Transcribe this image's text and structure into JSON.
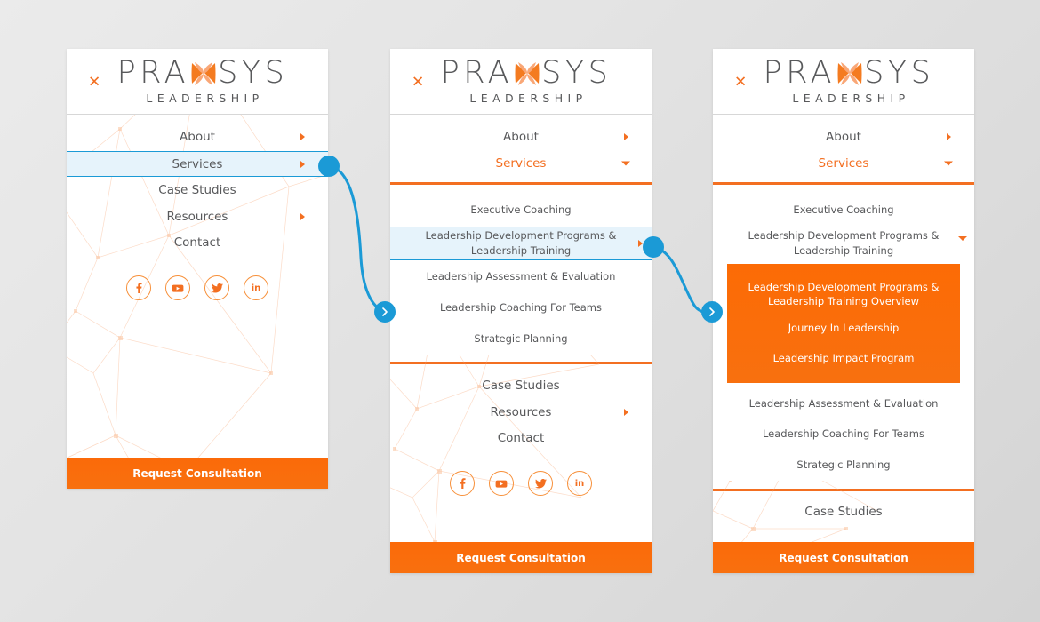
{
  "brand": {
    "close_icon": "close-x-icon",
    "name_part1": "PRA",
    "name_glyph": "butterfly-x-glyph",
    "name_part2": "SYS",
    "tagline": "LEADERSHIP"
  },
  "colors": {
    "orange": "#f36f21",
    "orange_bright": "#fb6a09",
    "blue": "#1b9ad6",
    "highlight_bg": "#e6f3fb",
    "text": "#58595b",
    "page_bg": "#e4e4e4"
  },
  "social": [
    {
      "name": "facebook",
      "label": "f"
    },
    {
      "name": "youtube",
      "label": ""
    },
    {
      "name": "twitter",
      "label": ""
    },
    {
      "name": "linkedin",
      "label": "in"
    }
  ],
  "cta_label": "Request Consultation",
  "panel1": {
    "menu": [
      {
        "label": "About",
        "arrow": "right"
      },
      {
        "label": "Services",
        "arrow": "right",
        "highlighted": true
      },
      {
        "label": "Case Studies",
        "arrow": "none"
      },
      {
        "label": "Resources",
        "arrow": "right"
      },
      {
        "label": "Contact",
        "arrow": "none"
      }
    ]
  },
  "panel2": {
    "menu_top": [
      {
        "label": "About",
        "arrow": "right"
      },
      {
        "label": "Services",
        "arrow": "down",
        "selected": true
      }
    ],
    "submenu": [
      {
        "label": "Executive Coaching",
        "arrow": "none"
      },
      {
        "label": "Leadership Development Programs & Leadership Training",
        "arrow": "right",
        "highlighted": true
      },
      {
        "label": "Leadership Assessment & Evaluation",
        "arrow": "none"
      },
      {
        "label": "Leadership Coaching For Teams",
        "arrow": "none"
      },
      {
        "label": "Strategic Planning",
        "arrow": "none"
      }
    ],
    "menu_bottom": [
      {
        "label": "Case Studies",
        "arrow": "none"
      },
      {
        "label": "Resources",
        "arrow": "right"
      },
      {
        "label": "Contact",
        "arrow": "none"
      }
    ]
  },
  "panel3": {
    "menu_top": [
      {
        "label": "About",
        "arrow": "right"
      },
      {
        "label": "Services",
        "arrow": "down",
        "selected": true
      }
    ],
    "submenu": [
      {
        "label": "Executive Coaching",
        "arrow": "none"
      },
      {
        "label": "Leadership Development Programs & Leadership Training",
        "arrow": "down",
        "expanded": true
      }
    ],
    "submenu_level3": [
      {
        "label": "Leadership Development Programs & Leadership Training Overview"
      },
      {
        "label": "Journey In Leadership"
      },
      {
        "label": "Leadership Impact Program"
      }
    ],
    "submenu_rest": [
      {
        "label": "Leadership Assessment & Evaluation",
        "arrow": "none"
      },
      {
        "label": "Leadership Coaching For Teams",
        "arrow": "none"
      },
      {
        "label": "Strategic Planning",
        "arrow": "none"
      }
    ],
    "menu_bottom": [
      {
        "label": "Case Studies",
        "arrow": "none"
      }
    ]
  },
  "connectors": [
    {
      "name": "connector-1",
      "from": "services-item-panel1",
      "to": "services-submenu-panel2",
      "icon": "chevron-right-icon"
    },
    {
      "name": "connector-2",
      "from": "leadership-dev-item-panel2",
      "to": "leadership-dev-submenu-panel3",
      "icon": "chevron-right-icon"
    }
  ]
}
